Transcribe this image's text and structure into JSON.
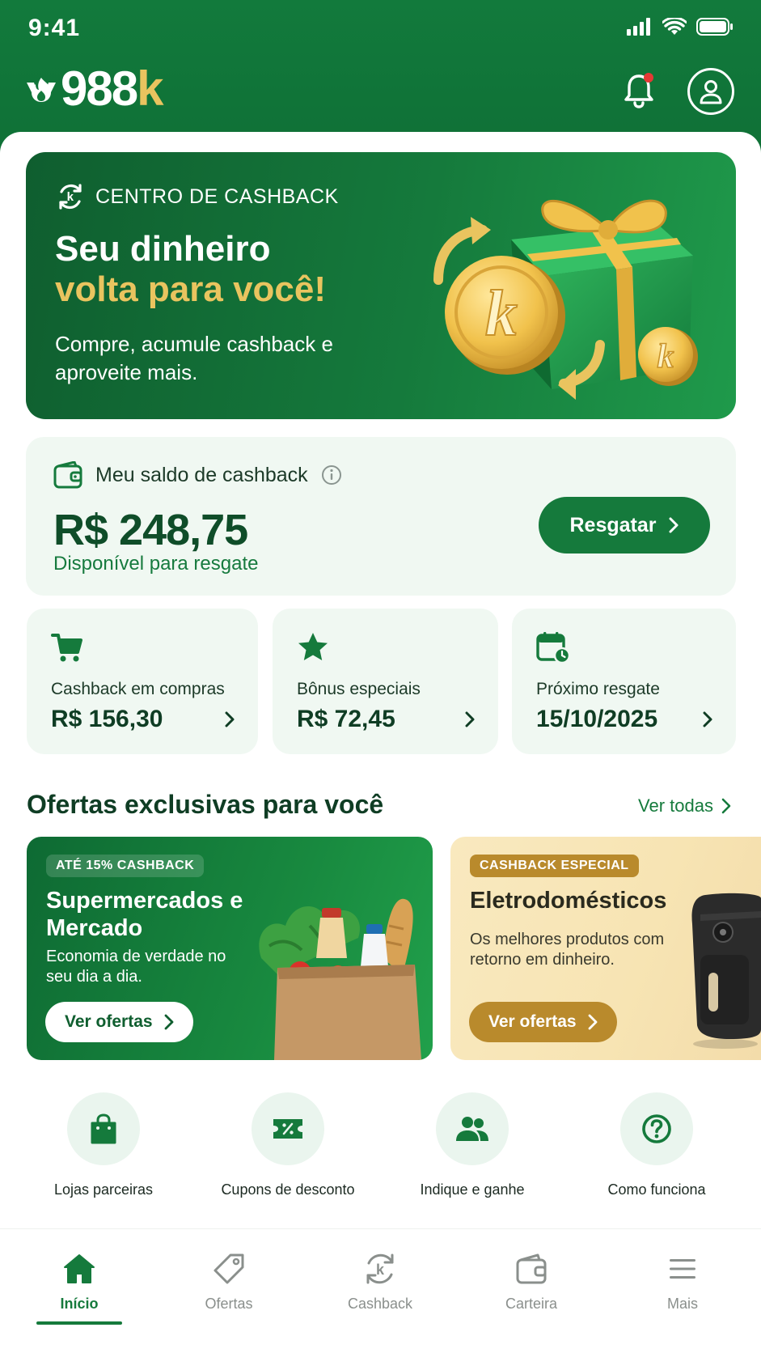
{
  "status_bar": {
    "time": "9:41"
  },
  "brand": {
    "name": "988",
    "accent": "k"
  },
  "colors": {
    "primary": "#157a3c",
    "gold": "#e9c45f",
    "notification": "#e53935"
  },
  "header": {
    "icons": [
      "bell-icon",
      "profile-icon"
    ]
  },
  "hero": {
    "tag": "CENTRO DE CASHBACK",
    "title_line1": "Seu dinheiro",
    "title_line2": "volta para você!",
    "subtitle": "Compre, acumule cashback e aproveite mais."
  },
  "balance": {
    "label": "Meu saldo de cashback",
    "value": "R$ 248,75",
    "sub": "Disponível para resgate",
    "button": "Resgatar"
  },
  "stats": [
    {
      "label": "Cashback em compras",
      "value": "R$ 156,30",
      "icon": "cart-icon"
    },
    {
      "label": "Bônus especiais",
      "value": "R$ 72,45",
      "icon": "star-icon"
    },
    {
      "label": "Próximo resgate",
      "value": "15/10/2025",
      "icon": "calendar-icon"
    }
  ],
  "offers": {
    "title": "Ofertas exclusivas para você",
    "see_all": "Ver todas",
    "items": [
      {
        "badge": "ATÉ 15% CASHBACK",
        "title": "Supermercados e Mercado",
        "desc": "Economia de verdade no seu dia a dia.",
        "button": "Ver ofertas"
      },
      {
        "badge": "CASHBACK ESPECIAL",
        "title": "Eletrodomésticos",
        "desc": "Os melhores produtos com retorno em dinheiro.",
        "button": "Ver ofertas"
      }
    ]
  },
  "shortcuts": [
    {
      "label": "Lojas parceiras",
      "icon": "shopping-bag-icon"
    },
    {
      "label": "Cupons de desconto",
      "icon": "coupon-icon"
    },
    {
      "label": "Indique e ganhe",
      "icon": "people-icon"
    },
    {
      "label": "Como funciona",
      "icon": "help-icon"
    }
  ],
  "nav": [
    {
      "label": "Início",
      "icon": "home-icon",
      "active": true
    },
    {
      "label": "Ofertas",
      "icon": "tag-icon",
      "active": false
    },
    {
      "label": "Cashback",
      "icon": "cashback-icon",
      "active": false
    },
    {
      "label": "Carteira",
      "icon": "wallet-icon",
      "active": false
    },
    {
      "label": "Mais",
      "icon": "menu-icon",
      "active": false
    }
  ]
}
